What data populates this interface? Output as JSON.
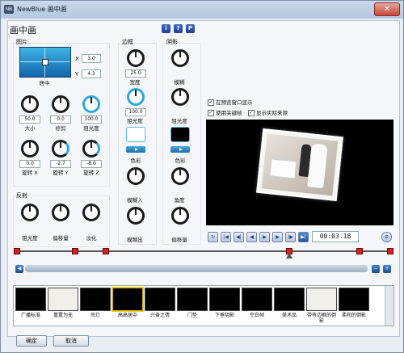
{
  "window": {
    "title": "NewBlue 画中画",
    "close": "×"
  },
  "header": {
    "title": "画中画",
    "help_i": "i",
    "help_q": "?",
    "help_p": "P"
  },
  "picture": {
    "group_label": "图片",
    "position_label": "居中",
    "x_label": "X",
    "x_value": "3.0",
    "y_label": "Y",
    "y_value": "4.3",
    "knobs": [
      {
        "value": "50.0",
        "label": "大小"
      },
      {
        "value": "0.0",
        "label": "修剪"
      },
      {
        "value": "100.0",
        "label": "阻光度"
      },
      {
        "value": "0.0",
        "label": "旋转 X"
      },
      {
        "value": "-2.7",
        "label": "旋转 Y"
      },
      {
        "value": "-8.0",
        "label": "旋转 Z"
      }
    ]
  },
  "reflection": {
    "group_label": "反射",
    "knobs": [
      {
        "label": "阻光度"
      },
      {
        "label": "偏移量"
      },
      {
        "label": "淡化"
      }
    ]
  },
  "border": {
    "group_label": "边框",
    "width_value": "25.0",
    "width_label": "宽度",
    "opacity_value": "100.0",
    "opacity_label": "阻光度",
    "color_label": "色彩",
    "fade_in_label": "模糊入",
    "fade_out_label": "模糊出",
    "swatch_color": "#ffffff"
  },
  "shadow": {
    "group_label": "阴影",
    "blur_label": "模糊",
    "opacity_label": "阻光度",
    "color_label": "色彩",
    "angle_label": "角度",
    "offset_label": "偏移量",
    "swatch_color": "#000000"
  },
  "options": {
    "show_in_preview": "在预览窗口显示",
    "use_keyframes": "使用关键帧",
    "show_source": "显示实际来源"
  },
  "transport": {
    "timecode": "00:03.18"
  },
  "presets": [
    {
      "label": "广播标准"
    },
    {
      "label": "重置为无"
    },
    {
      "label": "吊灯"
    },
    {
      "label": "高高居中"
    },
    {
      "label": "兴奋之倩"
    },
    {
      "label": "门垫"
    },
    {
      "label": "下垂阴影"
    },
    {
      "label": "空白帧"
    },
    {
      "label": "美术品"
    },
    {
      "label": "带有边框的倒影"
    },
    {
      "label": "柔和的倒影"
    }
  ],
  "footer": {
    "ok": "确定",
    "cancel": "取消"
  },
  "colors": {
    "accent": "#2aa9dd",
    "keyframe": "#d42121"
  }
}
